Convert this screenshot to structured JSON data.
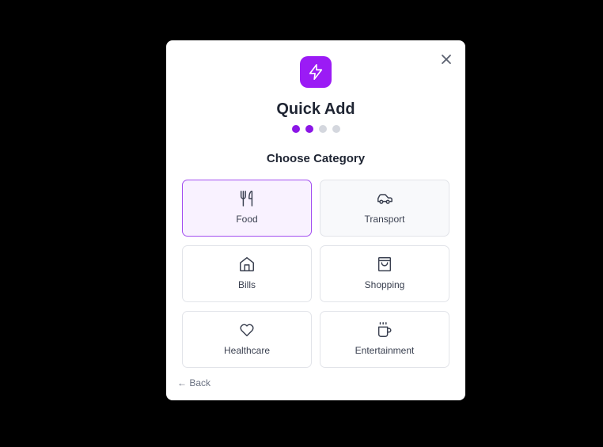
{
  "modal": {
    "title": "Quick Add",
    "subtitle": "Choose Category",
    "back_label": "← Back",
    "steps": {
      "total": 4,
      "current": 2
    },
    "colors": {
      "accent": "#9b1bf5",
      "selected_border": "#a24ef0",
      "selected_bg": "#f9f2ff"
    }
  },
  "categories": [
    {
      "label": "Food",
      "icon": "utensils-icon",
      "selected": true
    },
    {
      "label": "Transport",
      "icon": "car-icon",
      "selected": false
    },
    {
      "label": "Bills",
      "icon": "home-icon",
      "selected": false
    },
    {
      "label": "Shopping",
      "icon": "shopping-bag-icon",
      "selected": false
    },
    {
      "label": "Healthcare",
      "icon": "heart-icon",
      "selected": false
    },
    {
      "label": "Entertainment",
      "icon": "coffee-cup-icon",
      "selected": false
    }
  ]
}
